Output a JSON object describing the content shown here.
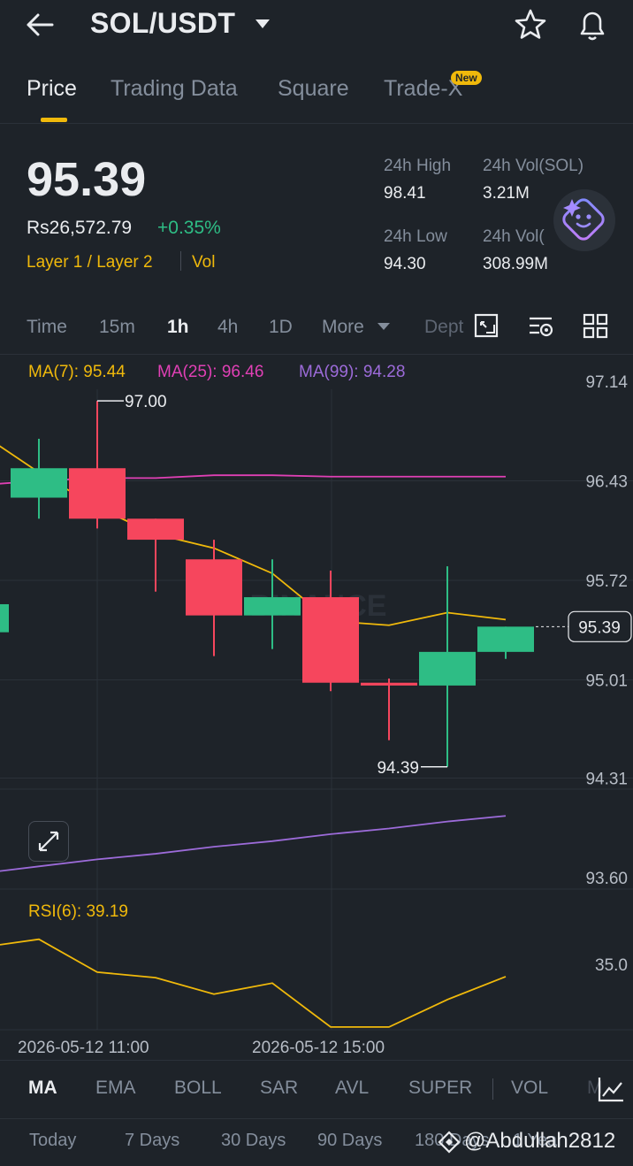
{
  "header": {
    "pair": "SOL/USDT",
    "icons": [
      "back-arrow-icon",
      "caret-down-icon",
      "star-icon",
      "bell-icon"
    ]
  },
  "tabs": [
    {
      "label": "Price",
      "active": true
    },
    {
      "label": "Trading Data"
    },
    {
      "label": "Square"
    },
    {
      "label": "Trade-X",
      "badge": "New"
    }
  ],
  "summary": {
    "price": "95.39",
    "fiat": "Rs26,572.79",
    "change": "+0.35%",
    "tag_layer": "Layer 1 / Layer 2",
    "tag_vol": "Vol",
    "stats": {
      "high_label": "24h High",
      "high_value": "98.41",
      "vol_sol_label": "24h Vol(SOL)",
      "vol_sol_value": "3.21M",
      "low_label": "24h Low",
      "low_value": "94.30",
      "vol_usdt_label": "24h Vol(",
      "vol_usdt_value": "308.99M"
    }
  },
  "intervals": {
    "items": [
      "Time",
      "15m",
      "1h",
      "4h",
      "1D"
    ],
    "active": "1h",
    "more": "More",
    "depth": "Dept"
  },
  "chart_data": {
    "type": "candlestick",
    "ma_legend": {
      "ma7": "MA(7): 95.44",
      "ma25": "MA(25): 96.46",
      "ma99": "MA(99): 94.28"
    },
    "y_ticks": [
      "97.14",
      "96.43",
      "95.72",
      "95.01",
      "94.31",
      "93.60"
    ],
    "ylim": [
      93.6,
      97.14
    ],
    "current_price": "95.39",
    "high_label": "97.00",
    "low_label": "94.39",
    "x_labels": [
      "2026-05-12 11:00",
      "2026-05-12 15:00"
    ],
    "candles": [
      {
        "o": 95.35,
        "c": 95.55,
        "h": 95.7,
        "l": 95.3
      },
      {
        "o": 96.31,
        "c": 96.52,
        "h": 96.73,
        "l": 96.16
      },
      {
        "o": 96.52,
        "c": 96.16,
        "h": 97.0,
        "l": 96.09
      },
      {
        "o": 96.16,
        "c": 96.01,
        "h": 96.16,
        "l": 95.64
      },
      {
        "o": 95.87,
        "c": 95.47,
        "h": 96.01,
        "l": 95.18
      },
      {
        "o": 95.47,
        "c": 95.6,
        "h": 95.87,
        "l": 95.23
      },
      {
        "o": 95.6,
        "c": 94.99,
        "h": 95.79,
        "l": 94.93
      },
      {
        "o": 94.99,
        "c": 94.97,
        "h": 95.02,
        "l": 94.58
      },
      {
        "o": 94.97,
        "c": 95.21,
        "h": 95.82,
        "l": 94.39
      },
      {
        "o": 95.21,
        "c": 95.39,
        "h": 95.39,
        "l": 95.16
      }
    ],
    "ma7": [
      96.77,
      96.49,
      96.24,
      96.05,
      95.95,
      95.77,
      95.43,
      95.4,
      95.49,
      95.44
    ],
    "ma25": [
      96.4,
      96.43,
      96.45,
      96.45,
      96.47,
      96.47,
      96.46,
      96.46,
      96.46,
      96.46
    ],
    "ma99": [
      93.63,
      93.68,
      93.73,
      93.77,
      93.82,
      93.86,
      93.91,
      93.95,
      94.0,
      94.04
    ],
    "rsi": {
      "label": "RSI(6): 39.19",
      "tick": "35.0",
      "values": [
        45,
        46,
        40,
        39,
        36,
        38,
        30,
        30,
        35,
        39.19
      ],
      "ylim": [
        29.5,
        49.5
      ]
    },
    "colors": {
      "up": "#2ebd85",
      "down": "#f6465d",
      "ma7": "#f0b90b",
      "ma25": "#e040b5",
      "ma99": "#9c6bd9",
      "rsi": "#f0b90b"
    }
  },
  "indicators": {
    "items": [
      "MA",
      "EMA",
      "BOLL",
      "SAR",
      "AVL",
      "SUPER",
      "VOL",
      "M"
    ],
    "active": "MA"
  },
  "periods": [
    "Today",
    "7 Days",
    "30 Days",
    "90 Days",
    "180 Days",
    "1 Year"
  ],
  "watermark": "@Abdullah2812",
  "chart_watermark": "BINANCE"
}
